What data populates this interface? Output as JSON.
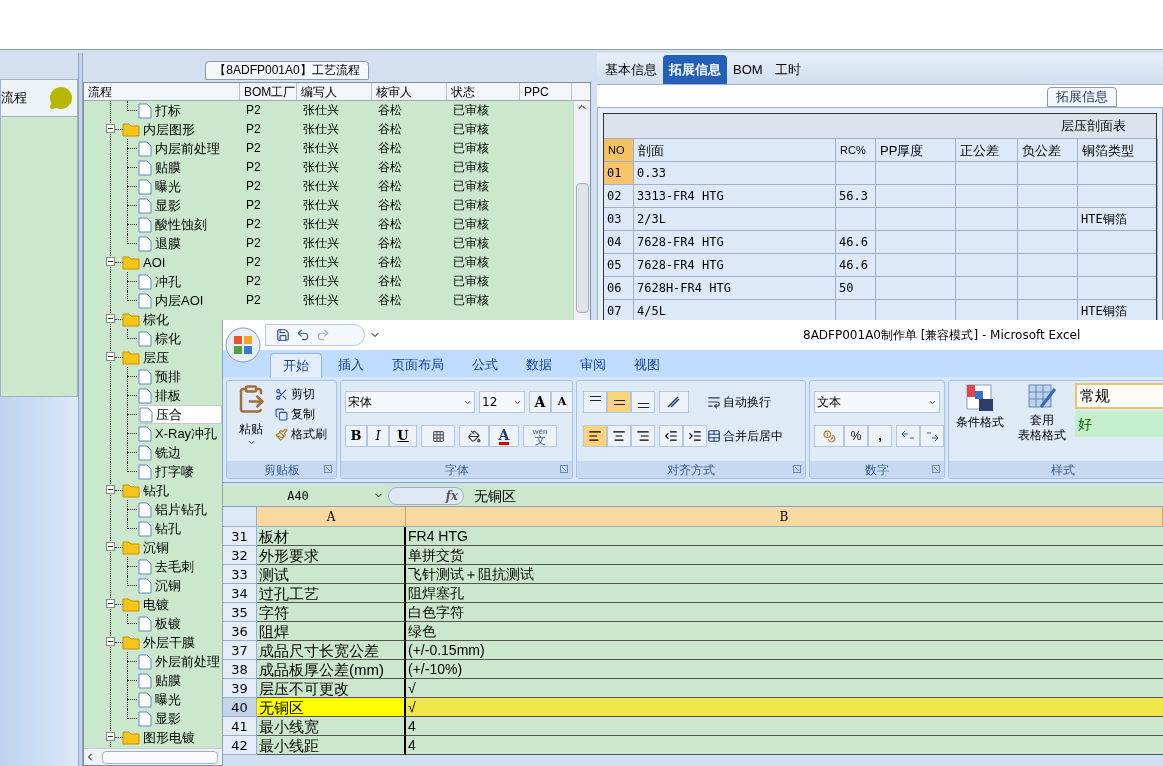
{
  "left_panel": {
    "title": "流程"
  },
  "process_tree": {
    "title": "【8ADFP001A0】工艺流程",
    "columns": [
      "流程",
      "BOM工厂",
      "编写人",
      "核审人",
      "状态",
      "PPC"
    ],
    "nodes": [
      {
        "children": [
          {
            "kind": "file",
            "name": "打标",
            "selected": false,
            "cells": [
              "P2",
              "张仕兴",
              "谷松",
              "已审核"
            ]
          }
        ]
      },
      {
        "kind": "folder",
        "name": "内层图形",
        "selected": false,
        "expanded": true,
        "cells": [
          "P2",
          "张仕兴",
          "谷松",
          "已审核"
        ],
        "children": [
          {
            "kind": "file",
            "name": "内层前处理",
            "selected": false,
            "cells": [
              "P2",
              "张仕兴",
              "谷松",
              "已审核"
            ]
          },
          {
            "kind": "file",
            "name": "贴膜",
            "selected": false,
            "cells": [
              "P2",
              "张仕兴",
              "谷松",
              "已审核"
            ]
          },
          {
            "kind": "file",
            "name": "曝光",
            "selected": false,
            "cells": [
              "P2",
              "张仕兴",
              "谷松",
              "已审核"
            ]
          },
          {
            "kind": "file",
            "name": "显影",
            "selected": false,
            "cells": [
              "P2",
              "张仕兴",
              "谷松",
              "已审核"
            ]
          },
          {
            "kind": "file",
            "name": "酸性蚀刻",
            "selected": false,
            "cells": [
              "P2",
              "张仕兴",
              "谷松",
              "已审核"
            ]
          },
          {
            "kind": "file",
            "name": "退膜",
            "selected": false,
            "cells": [
              "P2",
              "张仕兴",
              "谷松",
              "已审核"
            ]
          }
        ]
      },
      {
        "kind": "folder",
        "name": "AOI",
        "selected": false,
        "expanded": true,
        "cells": [
          "P2",
          "张仕兴",
          "谷松",
          "已审核"
        ],
        "children": [
          {
            "kind": "file",
            "name": "冲孔",
            "selected": false,
            "cells": [
              "P2",
              "张仕兴",
              "谷松",
              "已审核"
            ]
          },
          {
            "kind": "file",
            "name": "内层AOI",
            "selected": false,
            "cells": [
              "P2",
              "张仕兴",
              "谷松",
              "已审核"
            ]
          }
        ]
      },
      {
        "kind": "folder",
        "name": "棕化",
        "selected": false,
        "expanded": true,
        "children": [
          {
            "kind": "file",
            "name": "棕化",
            "selected": false
          }
        ]
      },
      {
        "kind": "folder",
        "name": "层压",
        "selected": false,
        "expanded": true,
        "children": [
          {
            "kind": "file",
            "name": "预排",
            "selected": false
          },
          {
            "kind": "file",
            "name": "排板",
            "selected": false
          },
          {
            "kind": "file",
            "name": "压合",
            "selected": true
          },
          {
            "kind": "file",
            "name": "X-Ray冲孔",
            "selected": false
          },
          {
            "kind": "file",
            "name": "铣边",
            "selected": false
          },
          {
            "kind": "file",
            "name": "打字嘜",
            "selected": false
          }
        ]
      },
      {
        "kind": "folder",
        "name": "钻孔",
        "selected": false,
        "expanded": true,
        "children": [
          {
            "kind": "file",
            "name": "铝片钻孔",
            "selected": false
          },
          {
            "kind": "file",
            "name": "钻孔",
            "selected": false
          }
        ]
      },
      {
        "kind": "folder",
        "name": "沉铜",
        "selected": false,
        "expanded": true,
        "children": [
          {
            "kind": "file",
            "name": "去毛刺",
            "selected": false
          },
          {
            "kind": "file",
            "name": "沉铜",
            "selected": false
          }
        ]
      },
      {
        "kind": "folder",
        "name": "电镀",
        "selected": false,
        "expanded": true,
        "children": [
          {
            "kind": "file",
            "name": "板镀",
            "selected": false
          }
        ]
      },
      {
        "kind": "folder",
        "name": "外层干膜",
        "selected": false,
        "expanded": true,
        "children": [
          {
            "kind": "file",
            "name": "外层前处理",
            "selected": false
          },
          {
            "kind": "file",
            "name": "贴膜",
            "selected": false
          },
          {
            "kind": "file",
            "name": "曝光",
            "selected": false
          },
          {
            "kind": "file",
            "name": "显影",
            "selected": false
          }
        ]
      },
      {
        "kind": "folder",
        "name": "图形电镀",
        "selected": false,
        "expanded": true
      }
    ]
  },
  "detail_panel": {
    "tabs": [
      {
        "label": "基本信息",
        "selected": false
      },
      {
        "label": "拓展信息",
        "selected": true
      },
      {
        "label": "BOM",
        "selected": false
      },
      {
        "label": "工时",
        "selected": false
      }
    ],
    "group_title": "拓展信息",
    "table": {
      "title": "层压剖面表",
      "columns": [
        "NO",
        "剖面",
        "RC%",
        "PP厚度",
        "正公差",
        "负公差",
        "铜箔类型"
      ],
      "rows": [
        {
          "selected": true,
          "cells": [
            "01",
            "0.33",
            "",
            "",
            "",
            "",
            ""
          ]
        },
        {
          "selected": false,
          "cells": [
            "02",
            "3313-FR4 HTG",
            "56.3",
            "",
            "",
            "",
            ""
          ]
        },
        {
          "selected": false,
          "cells": [
            "03",
            "2/3L",
            "",
            "",
            "",
            "",
            "HTE铜箔"
          ]
        },
        {
          "selected": false,
          "cells": [
            "04",
            "7628-FR4 HTG",
            "46.6",
            "",
            "",
            "",
            ""
          ]
        },
        {
          "selected": false,
          "cells": [
            "05",
            "7628-FR4 HTG",
            "46.6",
            "",
            "",
            "",
            ""
          ]
        },
        {
          "selected": false,
          "cells": [
            "06",
            "7628H-FR4 HTG",
            "50",
            "",
            "",
            "",
            ""
          ]
        },
        {
          "selected": false,
          "cells": [
            "07",
            "4/5L",
            "",
            "",
            "",
            "",
            "HTE铜箔"
          ]
        }
      ]
    }
  },
  "excel": {
    "title": "8ADFP001A0制作单  [兼容模式] - Microsoft Excel",
    "tabs": [
      {
        "label": "开始",
        "selected": true
      },
      {
        "label": "插入",
        "selected": false
      },
      {
        "label": "页面布局",
        "selected": false
      },
      {
        "label": "公式",
        "selected": false
      },
      {
        "label": "数据",
        "selected": false
      },
      {
        "label": "审阅",
        "selected": false
      },
      {
        "label": "视图",
        "selected": false
      }
    ],
    "clipboard": {
      "label": "剪贴板",
      "paste": "粘贴",
      "cut": "剪切",
      "copy": "复制",
      "format_painter": "格式刷"
    },
    "font": {
      "label": "字体",
      "name": "宋体",
      "size": "12",
      "grow": "A",
      "shrink": "A",
      "bold": "B",
      "italic": "I",
      "underline": "U",
      "font_color": "A",
      "phonetic_top": "wén",
      "phonetic_char": "文"
    },
    "alignment": {
      "label": "对齐方式",
      "vertical_buttons": [
        {
          "selected": false
        },
        {
          "selected": true
        },
        {
          "selected": false
        }
      ],
      "horizontal_buttons": [
        {
          "selected": true
        },
        {
          "selected": false
        },
        {
          "selected": false
        }
      ],
      "wrap": "自动换行",
      "merge": "合并后居中"
    },
    "number": {
      "label": "数字",
      "format": "文本",
      "percent": "%",
      "comma": ","
    },
    "styles": {
      "label": "样式",
      "conditional": "条件格式",
      "table_format": [
        "套用",
        "表格格式"
      ],
      "normal": "常规",
      "good": "好"
    },
    "name_box": "A40",
    "fx": "fx",
    "formula": "无铜区",
    "columns": [
      "A",
      "B"
    ],
    "rows": [
      {
        "number": "31",
        "a": "板材",
        "b": "FR4 HTG",
        "selected": false
      },
      {
        "number": "32",
        "a": "外形要求",
        "b": "单拼交货",
        "selected": false
      },
      {
        "number": "33",
        "a": "测试",
        "b": "飞针测试＋阻抗测试",
        "selected": false
      },
      {
        "number": "34",
        "a": "过孔工艺",
        "b": "阻焊塞孔",
        "selected": false
      },
      {
        "number": "35",
        "a": "字符",
        "b": "白色字符",
        "selected": false
      },
      {
        "number": "36",
        "a": "阻焊",
        "b": "绿色",
        "selected": false
      },
      {
        "number": "37",
        "a": "成品尺寸长宽公差",
        "b": "(+/-0.15mm)",
        "selected": false
      },
      {
        "number": "38",
        "a": "成品板厚公差(mm)",
        "b": "(+/-10%)",
        "selected": false
      },
      {
        "number": "39",
        "a": "层压不可更改",
        "b": "√",
        "selected": false
      },
      {
        "number": "40",
        "a": "无铜区",
        "b": "√",
        "selected": true
      },
      {
        "number": "41",
        "a": "最小线宽",
        "b": "4",
        "selected": false
      },
      {
        "number": "42",
        "a": "最小线距",
        "b": "4",
        "selected": false
      }
    ]
  }
}
